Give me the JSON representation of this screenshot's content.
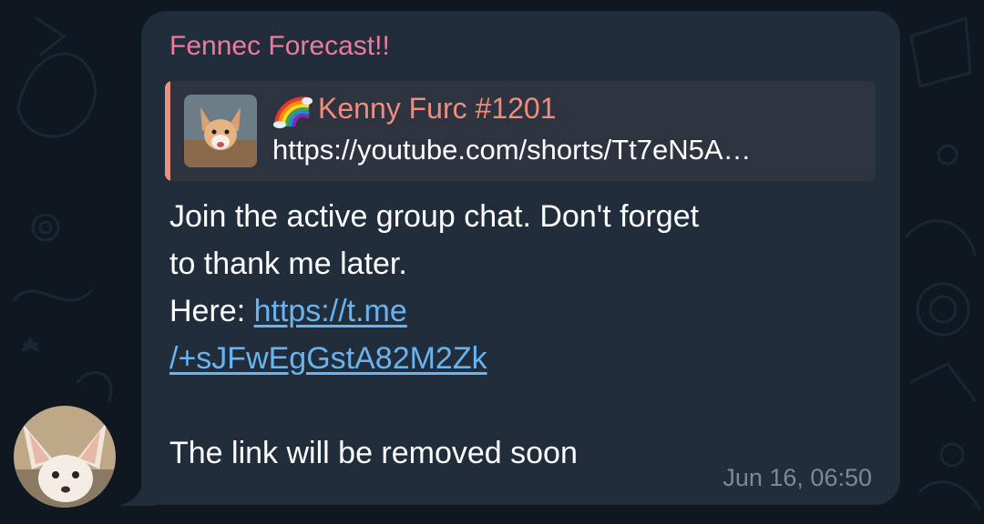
{
  "message": {
    "sender_name": "Fennec Forecast!!",
    "reply": {
      "emoji": "rainbow-emoji",
      "author": "Kenny Furc #1201",
      "text": "https://youtube.com/shorts/Tt7eN5A…"
    },
    "body": {
      "line1": "Join the active group chat. Don't forget",
      "line2": "to thank me later.",
      "here_label": "Here: ",
      "link_part1": "https://t.me",
      "link_part2": "/+sJFwEgGstA82M2Zk",
      "final_line": "The link will be removed soon"
    },
    "timestamp": "Jun 16, 06:50"
  },
  "colors": {
    "background": "#0f1820",
    "bubble": "#212d3b",
    "sender_name": "#ee7a9c",
    "reply_accent": "#e89380",
    "reply_background": "#2e3340",
    "link": "#69b4f0",
    "timestamp": "#7b8a99"
  },
  "icons": {
    "avatar": "fennec-fox-avatar",
    "reply_thumbnail": "fox-video-thumbnail"
  }
}
